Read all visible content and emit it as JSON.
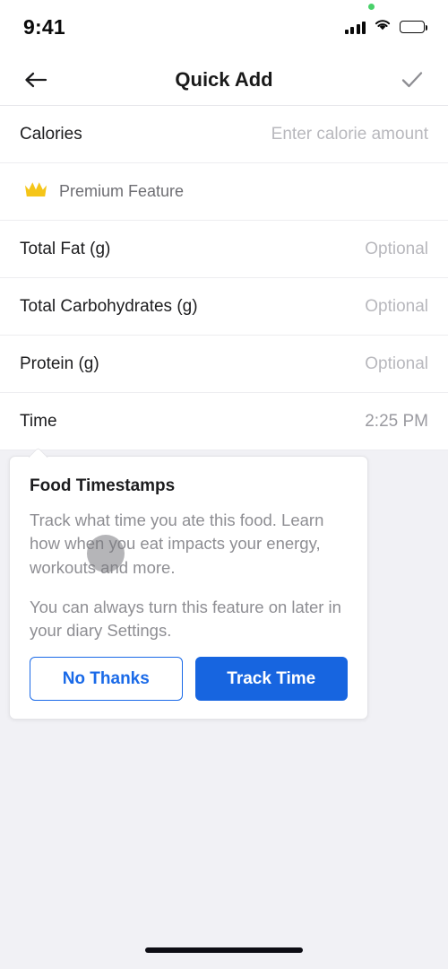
{
  "status_bar": {
    "time": "9:41",
    "icons": {
      "recording_dot": "recording-indicator-dot",
      "signal": "cellular-signal-icon",
      "wifi": "wifi-icon",
      "battery": "battery-icon"
    }
  },
  "header": {
    "back_icon": "back-arrow-icon",
    "title": "Quick Add",
    "confirm_icon": "checkmark-icon"
  },
  "form": {
    "rows": [
      {
        "label": "Calories",
        "value": "Enter calorie amount",
        "filled": false
      },
      {
        "label": "Total Fat (g)",
        "value": "Optional",
        "filled": false
      },
      {
        "label": "Total Carbohydrates (g)",
        "value": "Optional",
        "filled": false
      },
      {
        "label": "Protein (g)",
        "value": "Optional",
        "filled": false
      },
      {
        "label": "Time",
        "value": "2:25 PM",
        "filled": true
      }
    ],
    "premium": {
      "icon": "crown-icon",
      "label": "Premium Feature",
      "icon_color": "#f5c518"
    }
  },
  "tooltip": {
    "title": "Food Timestamps",
    "paragraph_1": "Track what time you ate this food. Learn how when you eat impacts your energy, workouts and more.",
    "paragraph_2": "You can always turn this feature on later in your diary Settings.",
    "decline_label": "No Thanks",
    "accept_label": "Track Time"
  },
  "colors": {
    "accent_blue": "#1765e0",
    "secondary_blue": "#1a6ae8",
    "premium_gold": "#f5c518",
    "page_background": "#f1f1f5",
    "card_background": "#ffffff",
    "placeholder_text": "#b8b8bd",
    "body_text": "#8e8e93"
  }
}
